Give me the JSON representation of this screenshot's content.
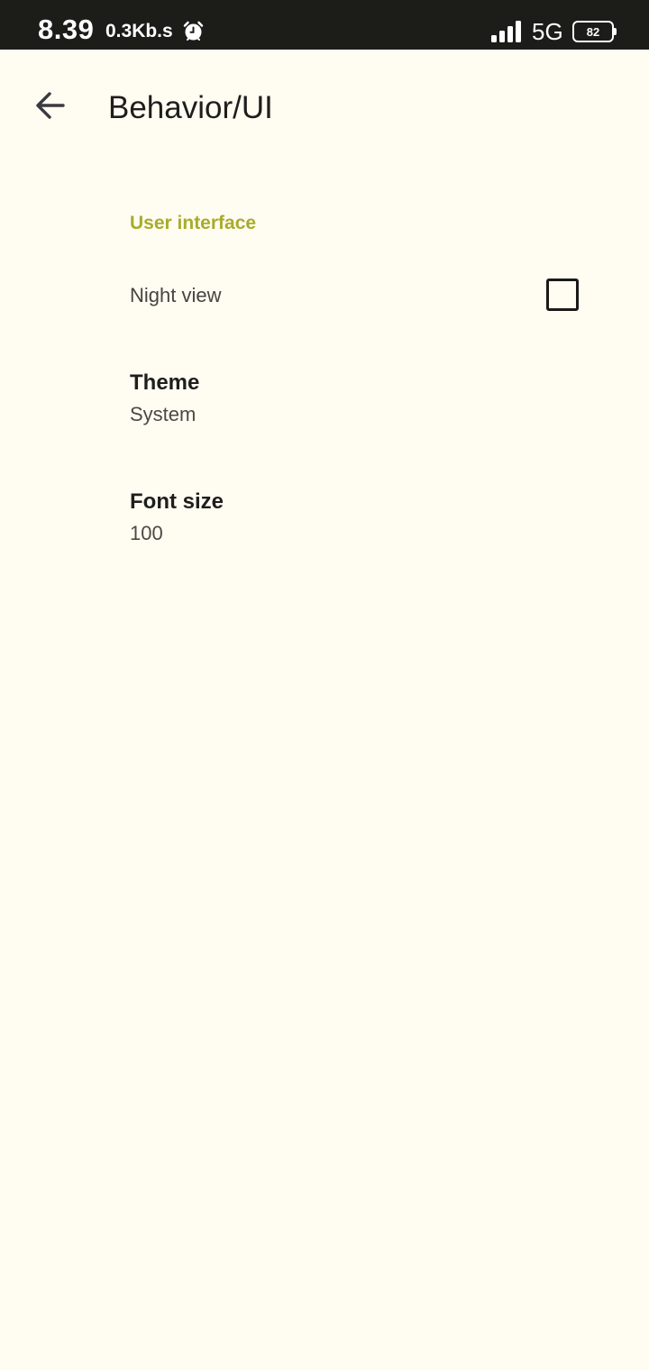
{
  "status_bar": {
    "time": "8.39",
    "net_speed": "0.3Kb.s",
    "alarm_icon": "alarm-clock-icon",
    "signal_icon": "signal-bars-icon",
    "network_type": "5G",
    "battery_level": "82"
  },
  "app_bar": {
    "back_icon": "arrow-left-icon",
    "title": "Behavior/UI"
  },
  "section": {
    "header": "User interface"
  },
  "preferences": {
    "night_view": {
      "label": "Night view",
      "checked": false
    },
    "theme": {
      "title": "Theme",
      "summary": "System"
    },
    "font_size": {
      "title": "Font size",
      "summary": "100"
    }
  },
  "colors": {
    "background": "#fffcf2",
    "status_bar": "#1c1c19",
    "accent": "#a8ac2c",
    "text_primary": "#1e1e1c",
    "text_secondary": "#4a4a44"
  }
}
